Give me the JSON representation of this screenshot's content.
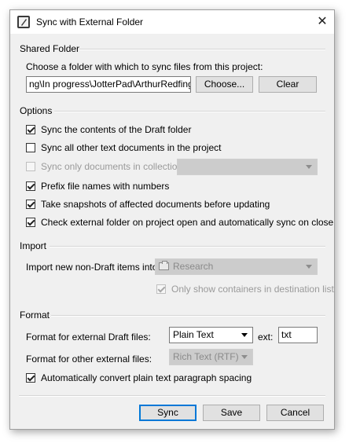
{
  "window": {
    "title": "Sync with External Folder",
    "close_glyph": "✕",
    "app_icon": "scrivener-app-icon"
  },
  "shared_folder": {
    "section_title": "Shared Folder",
    "instruction": "Choose a folder with which to sync files from this project:",
    "path_value": "ng\\In progress\\JotterPad\\ArthurRedfinger",
    "choose_label": "Choose...",
    "clear_label": "Clear"
  },
  "options": {
    "section_title": "Options",
    "items": [
      {
        "label": "Sync the contents of the Draft folder",
        "checked": true,
        "enabled": true
      },
      {
        "label": "Sync all other text documents in the project",
        "checked": false,
        "enabled": true
      },
      {
        "label": "Sync only documents in collection:",
        "checked": false,
        "enabled": false
      },
      {
        "label": "Prefix file names with numbers",
        "checked": true,
        "enabled": true
      },
      {
        "label": "Take snapshots of affected documents before updating",
        "checked": true,
        "enabled": true
      },
      {
        "label": "Check external folder on project open and automatically sync on close",
        "checked": true,
        "enabled": true
      }
    ],
    "collection_select_value": ""
  },
  "import": {
    "section_title": "Import",
    "label": "Import new non-Draft items into:",
    "destination_value": "Research",
    "destination_icon": "folder-icon",
    "only_containers_label": "Only show containers in destination list",
    "only_containers_checked": true
  },
  "format": {
    "section_title": "Format",
    "draft_label": "Format for external Draft files:",
    "draft_value": "Plain Text",
    "ext_label": "ext:",
    "ext_value": "txt",
    "other_label": "Format for other external files:",
    "other_value": "Rich Text (RTF)",
    "convert_label": "Automatically convert plain text paragraph spacing",
    "convert_checked": true
  },
  "buttons": {
    "sync": "Sync",
    "save": "Save",
    "cancel": "Cancel"
  }
}
